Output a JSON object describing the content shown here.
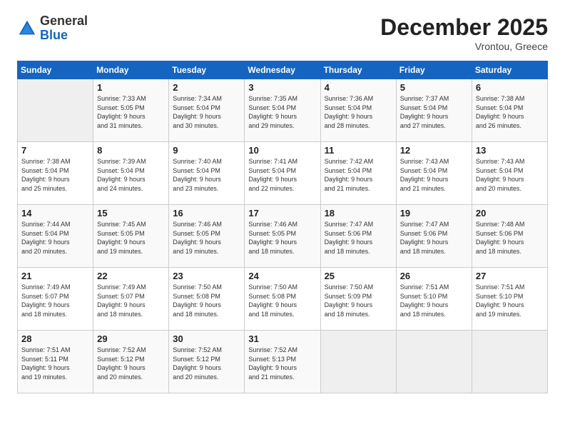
{
  "logo": {
    "general": "General",
    "blue": "Blue"
  },
  "header": {
    "month": "December 2025",
    "location": "Vrontou, Greece"
  },
  "days_of_week": [
    "Sunday",
    "Monday",
    "Tuesday",
    "Wednesday",
    "Thursday",
    "Friday",
    "Saturday"
  ],
  "weeks": [
    [
      {
        "day": "",
        "info": ""
      },
      {
        "day": "1",
        "info": "Sunrise: 7:33 AM\nSunset: 5:05 PM\nDaylight: 9 hours\nand 31 minutes."
      },
      {
        "day": "2",
        "info": "Sunrise: 7:34 AM\nSunset: 5:04 PM\nDaylight: 9 hours\nand 30 minutes."
      },
      {
        "day": "3",
        "info": "Sunrise: 7:35 AM\nSunset: 5:04 PM\nDaylight: 9 hours\nand 29 minutes."
      },
      {
        "day": "4",
        "info": "Sunrise: 7:36 AM\nSunset: 5:04 PM\nDaylight: 9 hours\nand 28 minutes."
      },
      {
        "day": "5",
        "info": "Sunrise: 7:37 AM\nSunset: 5:04 PM\nDaylight: 9 hours\nand 27 minutes."
      },
      {
        "day": "6",
        "info": "Sunrise: 7:38 AM\nSunset: 5:04 PM\nDaylight: 9 hours\nand 26 minutes."
      }
    ],
    [
      {
        "day": "7",
        "info": "Sunrise: 7:38 AM\nSunset: 5:04 PM\nDaylight: 9 hours\nand 25 minutes."
      },
      {
        "day": "8",
        "info": "Sunrise: 7:39 AM\nSunset: 5:04 PM\nDaylight: 9 hours\nand 24 minutes."
      },
      {
        "day": "9",
        "info": "Sunrise: 7:40 AM\nSunset: 5:04 PM\nDaylight: 9 hours\nand 23 minutes."
      },
      {
        "day": "10",
        "info": "Sunrise: 7:41 AM\nSunset: 5:04 PM\nDaylight: 9 hours\nand 22 minutes."
      },
      {
        "day": "11",
        "info": "Sunrise: 7:42 AM\nSunset: 5:04 PM\nDaylight: 9 hours\nand 21 minutes."
      },
      {
        "day": "12",
        "info": "Sunrise: 7:43 AM\nSunset: 5:04 PM\nDaylight: 9 hours\nand 21 minutes."
      },
      {
        "day": "13",
        "info": "Sunrise: 7:43 AM\nSunset: 5:04 PM\nDaylight: 9 hours\nand 20 minutes."
      }
    ],
    [
      {
        "day": "14",
        "info": "Sunrise: 7:44 AM\nSunset: 5:04 PM\nDaylight: 9 hours\nand 20 minutes."
      },
      {
        "day": "15",
        "info": "Sunrise: 7:45 AM\nSunset: 5:05 PM\nDaylight: 9 hours\nand 19 minutes."
      },
      {
        "day": "16",
        "info": "Sunrise: 7:46 AM\nSunset: 5:05 PM\nDaylight: 9 hours\nand 19 minutes."
      },
      {
        "day": "17",
        "info": "Sunrise: 7:46 AM\nSunset: 5:05 PM\nDaylight: 9 hours\nand 18 minutes."
      },
      {
        "day": "18",
        "info": "Sunrise: 7:47 AM\nSunset: 5:06 PM\nDaylight: 9 hours\nand 18 minutes."
      },
      {
        "day": "19",
        "info": "Sunrise: 7:47 AM\nSunset: 5:06 PM\nDaylight: 9 hours\nand 18 minutes."
      },
      {
        "day": "20",
        "info": "Sunrise: 7:48 AM\nSunset: 5:06 PM\nDaylight: 9 hours\nand 18 minutes."
      }
    ],
    [
      {
        "day": "21",
        "info": "Sunrise: 7:49 AM\nSunset: 5:07 PM\nDaylight: 9 hours\nand 18 minutes."
      },
      {
        "day": "22",
        "info": "Sunrise: 7:49 AM\nSunset: 5:07 PM\nDaylight: 9 hours\nand 18 minutes."
      },
      {
        "day": "23",
        "info": "Sunrise: 7:50 AM\nSunset: 5:08 PM\nDaylight: 9 hours\nand 18 minutes."
      },
      {
        "day": "24",
        "info": "Sunrise: 7:50 AM\nSunset: 5:08 PM\nDaylight: 9 hours\nand 18 minutes."
      },
      {
        "day": "25",
        "info": "Sunrise: 7:50 AM\nSunset: 5:09 PM\nDaylight: 9 hours\nand 18 minutes."
      },
      {
        "day": "26",
        "info": "Sunrise: 7:51 AM\nSunset: 5:10 PM\nDaylight: 9 hours\nand 18 minutes."
      },
      {
        "day": "27",
        "info": "Sunrise: 7:51 AM\nSunset: 5:10 PM\nDaylight: 9 hours\nand 19 minutes."
      }
    ],
    [
      {
        "day": "28",
        "info": "Sunrise: 7:51 AM\nSunset: 5:11 PM\nDaylight: 9 hours\nand 19 minutes."
      },
      {
        "day": "29",
        "info": "Sunrise: 7:52 AM\nSunset: 5:12 PM\nDaylight: 9 hours\nand 20 minutes."
      },
      {
        "day": "30",
        "info": "Sunrise: 7:52 AM\nSunset: 5:12 PM\nDaylight: 9 hours\nand 20 minutes."
      },
      {
        "day": "31",
        "info": "Sunrise: 7:52 AM\nSunset: 5:13 PM\nDaylight: 9 hours\nand 21 minutes."
      },
      {
        "day": "",
        "info": ""
      },
      {
        "day": "",
        "info": ""
      },
      {
        "day": "",
        "info": ""
      }
    ]
  ]
}
